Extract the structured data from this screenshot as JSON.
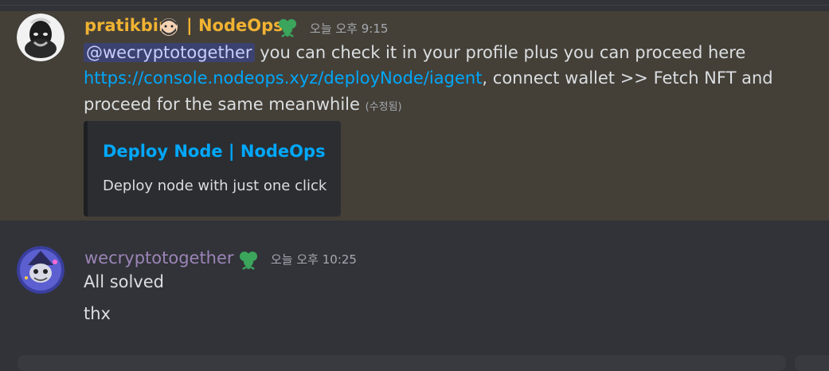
{
  "messages": [
    {
      "username": "pratikbin",
      "username_suffix": "| NodeOps",
      "timestamp": "오늘 오후 9:15",
      "mention": "@wecryptotogether",
      "line1_rest": " you can check it in your profile plus you can proceed here",
      "link": "https://console.nodeops.xyz/deployNode/iagent",
      "line2_rest": ", connect wallet >> Fetch NFT and",
      "line3": "proceed for the same meanwhile",
      "edited": "(수정됨)",
      "embed": {
        "title": "Deploy Node | NodeOps",
        "description": "Deploy node with just one click"
      }
    },
    {
      "username": "wecryptotogether",
      "timestamp": "오늘 오후 10:25",
      "line1": "All solved",
      "line2": "thx"
    }
  ],
  "colors": {
    "highlight_bg": "#444038",
    "channel_bg": "#313338",
    "username1": "#f0b232",
    "username2": "#9b84b7",
    "link": "#00a8fc",
    "badge": "#3ba55c"
  },
  "icons": {
    "face_emoji": "bearded-face-emoji",
    "badge": "clover-badge-icon"
  }
}
